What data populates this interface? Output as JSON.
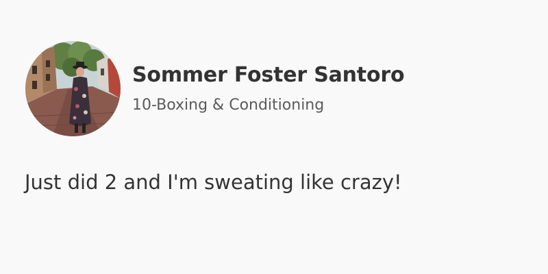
{
  "post": {
    "author": {
      "name": "Sommer Foster Santoro",
      "class_name": "10-Boxing & Conditioning",
      "avatar_icon": "profile-photo"
    },
    "message": "Just did 2 and I'm sweating like crazy!"
  },
  "colors": {
    "background": "#f9f9fa",
    "primary_text": "#333333",
    "secondary_text": "#5a5a5a"
  }
}
